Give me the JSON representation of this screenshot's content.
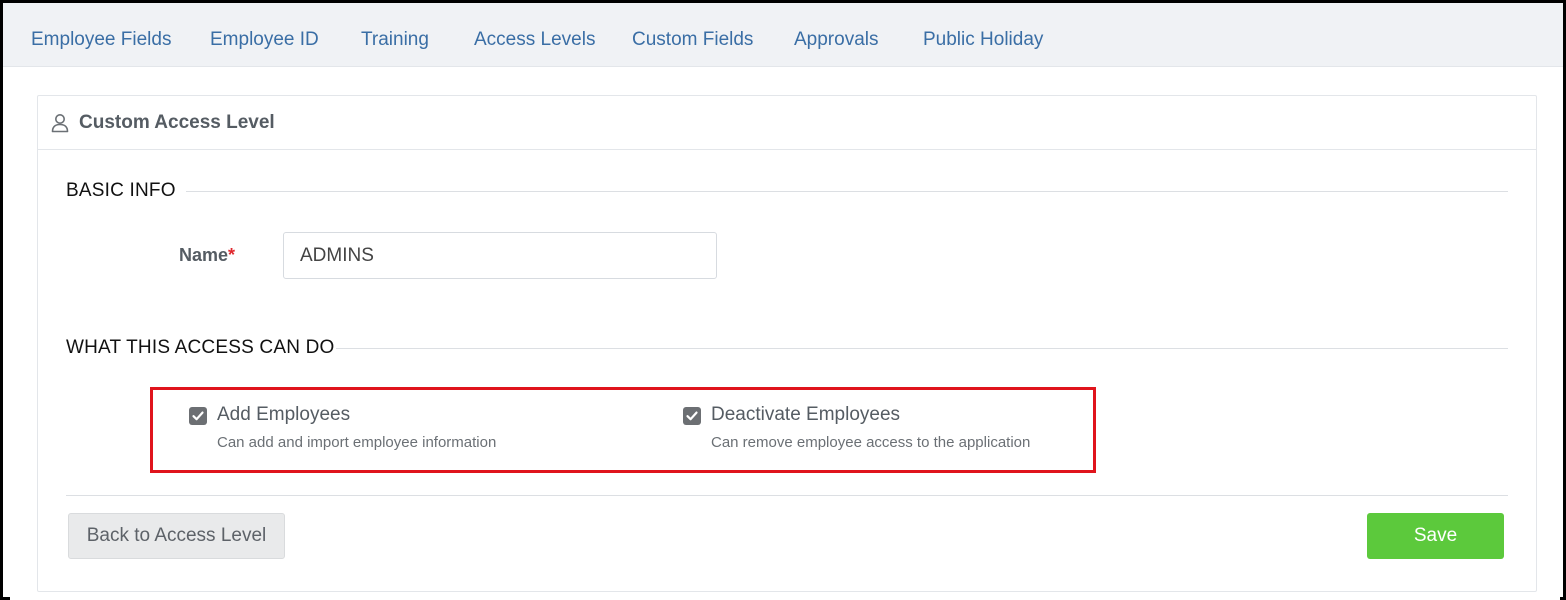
{
  "tabs": [
    {
      "label": "Employee Fields"
    },
    {
      "label": "Employee ID"
    },
    {
      "label": "Training"
    },
    {
      "label": "Access Levels"
    },
    {
      "label": "Custom Fields"
    },
    {
      "label": "Approvals"
    },
    {
      "label": "Public Holiday"
    }
  ],
  "card": {
    "title": "Custom Access Level",
    "icon": "user-icon"
  },
  "basic_info": {
    "heading": "BASIC INFO",
    "name_label": "Name",
    "required_marker": "*",
    "name_value": "ADMINS"
  },
  "permissions": {
    "heading": "WHAT THIS ACCESS CAN DO",
    "items": [
      {
        "label": "Add Employees",
        "description": "Can add and import employee information",
        "checked": true
      },
      {
        "label": "Deactivate Employees",
        "description": "Can remove employee access to the application",
        "checked": true
      }
    ]
  },
  "actions": {
    "back_label": "Back to Access Level",
    "save_label": "Save"
  },
  "colors": {
    "tab_text": "#3a6ea5",
    "save_button": "#5cc93c",
    "highlight": "#e0141c",
    "required": "#e0282e"
  }
}
